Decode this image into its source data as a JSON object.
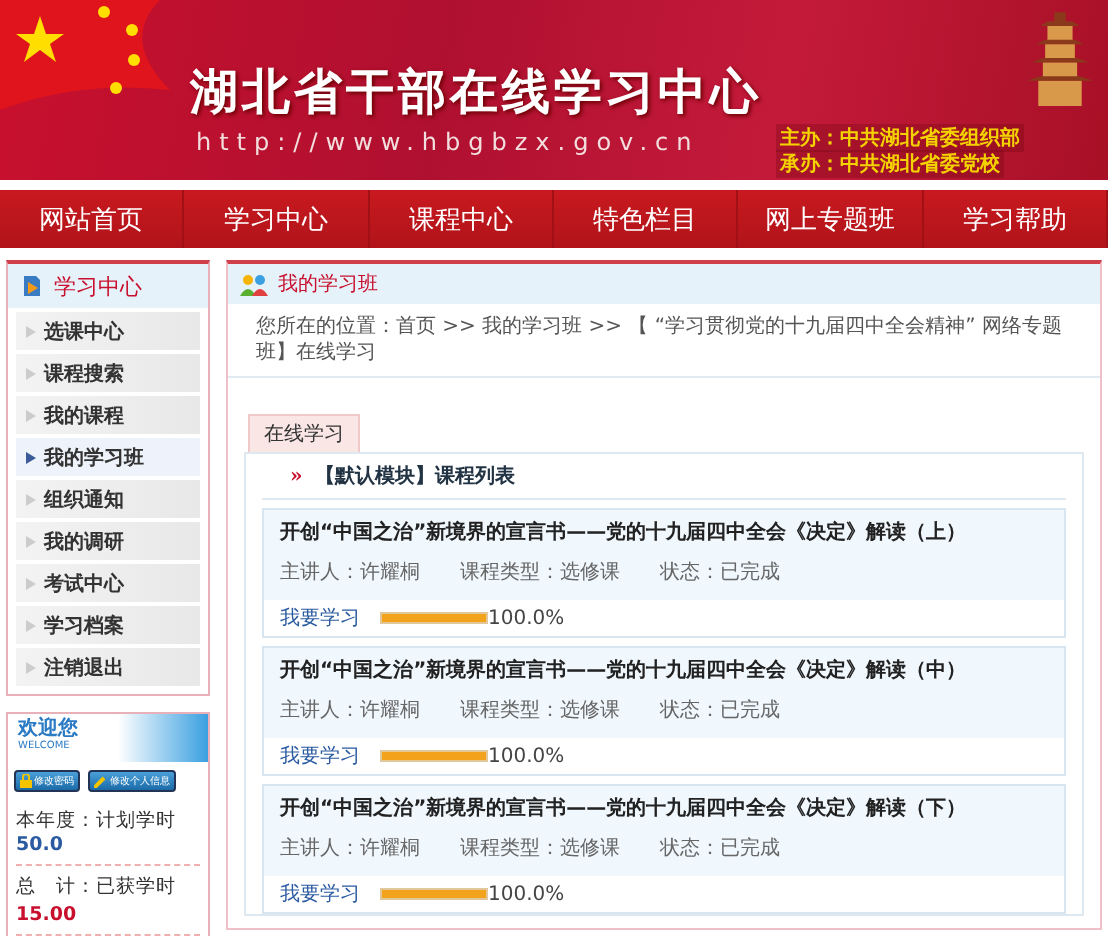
{
  "banner": {
    "title": "湖北省干部在线学习中心",
    "url": "http://www.hbgbzx.gov.cn",
    "sponsors": [
      "主办：中共湖北省委组织部",
      "承办：中共湖北省委党校"
    ]
  },
  "nav": [
    {
      "label": "网站首页",
      "selected": false
    },
    {
      "label": "学习中心",
      "selected": false
    },
    {
      "label": "课程中心",
      "selected": false
    },
    {
      "label": "特色栏目",
      "selected": false
    },
    {
      "label": "网上专题班",
      "selected": false
    },
    {
      "label": "学习帮助",
      "selected": false
    }
  ],
  "sidebar": {
    "title": "学习中心",
    "items": [
      {
        "label": "选课中心",
        "selected": false
      },
      {
        "label": "课程搜索",
        "selected": false
      },
      {
        "label": "我的课程",
        "selected": false
      },
      {
        "label": "我的学习班",
        "selected": true
      },
      {
        "label": "组织通知",
        "selected": false
      },
      {
        "label": "我的调研",
        "selected": false
      },
      {
        "label": "考试中心",
        "selected": false
      },
      {
        "label": "学习档案",
        "selected": false
      },
      {
        "label": "注销退出",
        "selected": false
      }
    ]
  },
  "welcome": {
    "title": "欢迎您",
    "subtitle": "WELCOME",
    "buttons": [
      "修改密码",
      "修改个人信息"
    ],
    "stats": [
      {
        "label": "本年度：计划学时",
        "value": "50.0"
      },
      {
        "label": "总　计：已获学时",
        "value": "15.00"
      }
    ]
  },
  "main": {
    "title": "我的学习班",
    "breadcrumb": "您所在的位置：首页 >> 我的学习班 >> 【 “学习贯彻党的十九届四中全会精神” 网络专题班】在线学习",
    "tab": {
      "label": "在线学习",
      "selected": true
    },
    "module_title": "【默认模块】课程列表",
    "module_marker": "»",
    "courses": [
      {
        "title": "开创“中国之治”新境界的宣言书——党的十九届四中全会《决定》解读（上）",
        "lecturer": "主讲人：许耀桐",
        "type": "课程类型：选修课",
        "status": "状态：已完成",
        "action": "我要学习",
        "level": 1.0,
        "reading": "100.0%"
      },
      {
        "title": "开创“中国之治”新境界的宣言书——党的十九届四中全会《决定》解读（中）",
        "lecturer": "主讲人：许耀桐",
        "type": "课程类型：选修课",
        "status": "状态：已完成",
        "action": "我要学习",
        "level": 1.0,
        "reading": "100.0%"
      },
      {
        "title": "开创“中国之治”新境界的宣言书——党的十九届四中全会《决定》解读（下）",
        "lecturer": "主讲人：许耀桐",
        "type": "课程类型：选修课",
        "status": "状态：已完成",
        "action": "我要学习",
        "level": 1.0,
        "reading": "100.0%"
      }
    ]
  }
}
